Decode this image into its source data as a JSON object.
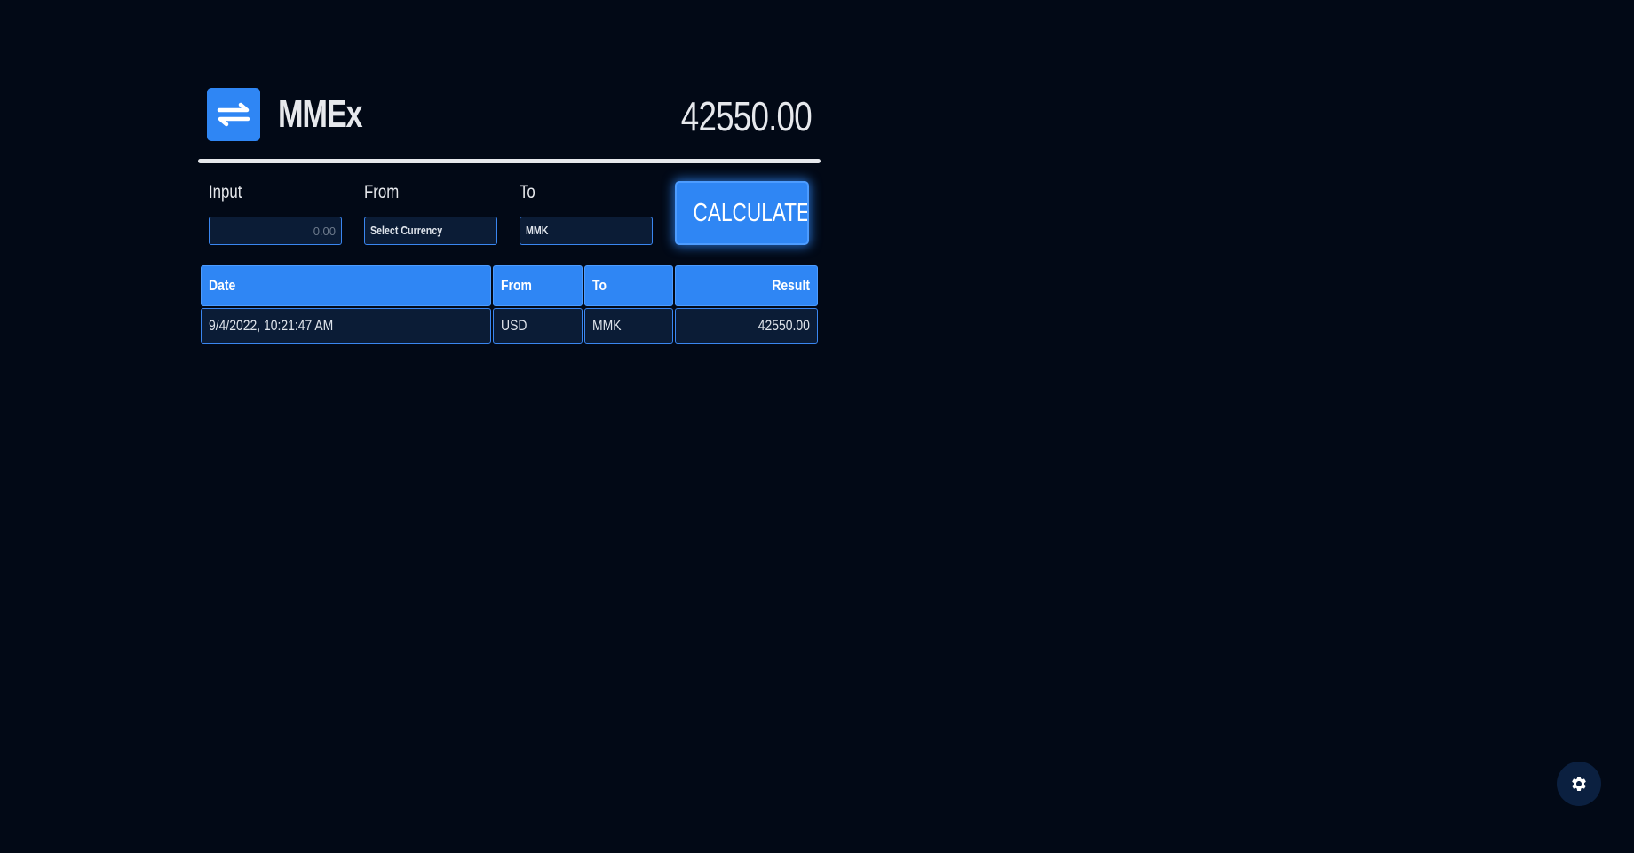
{
  "app": {
    "title": "MMEx",
    "total": "42550.00"
  },
  "form": {
    "input_label": "Input",
    "input_placeholder": "0.00",
    "from_label": "From",
    "from_value": "Select Currency",
    "to_label": "To",
    "to_value": "MMK",
    "calculate_label": "CALCULATE"
  },
  "history": {
    "columns": [
      "Date",
      "From",
      "To",
      "Result"
    ],
    "rows": [
      {
        "date": "9/4/2022, 10:21:47 AM",
        "from": "USD",
        "to": "MMK",
        "result": "42550.00"
      }
    ]
  },
  "icons": {
    "logo": "swap-arrows-icon",
    "settings": "gear-icon"
  },
  "colors": {
    "background": "#020916",
    "accent": "#2f86f4",
    "field_bg": "#0b1c36"
  }
}
